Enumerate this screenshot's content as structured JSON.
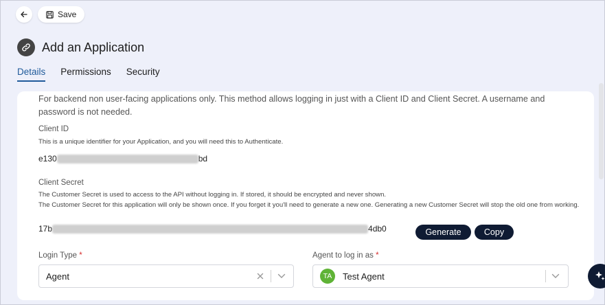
{
  "toolbar": {
    "save_label": "Save"
  },
  "page": {
    "title": "Add an Application"
  },
  "tabs": [
    {
      "label": "Details",
      "active": true
    },
    {
      "label": "Permissions",
      "active": false
    },
    {
      "label": "Security",
      "active": false
    }
  ],
  "content": {
    "description": "For backend non user-facing applications only. This method allows logging in just with a Client ID and Client Secret. A username and password is not needed.",
    "client_id": {
      "label": "Client ID",
      "help": "This is a unique identifier for your Application, and you will need this to Authenticate.",
      "value_prefix": "e130",
      "value_suffix": "bd"
    },
    "client_secret": {
      "label": "Client Secret",
      "help_1": "The Customer Secret is used to access to the API without logging in. If stored, it should be encrypted and never shown.",
      "help_2": "The Customer Secret for this application will only be shown once. If you forget it you'll need to generate a new one. Generating a new Customer Secret will stop the old one from working.",
      "value_prefix": "17b",
      "value_suffix": "4db0",
      "generate_label": "Generate",
      "copy_label": "Copy"
    },
    "login_type": {
      "label": "Login Type",
      "required_mark": "*",
      "value": "Agent"
    },
    "agent": {
      "label": "Agent to log in as",
      "required_mark": "*",
      "initials": "TA",
      "value": "Test Agent"
    }
  },
  "colors": {
    "accent": "#1f5a9a",
    "dark_button": "#0f1b33",
    "avatar": "#5fb336",
    "required": "#d62d2d",
    "background": "#eef0fa"
  },
  "icons": [
    "back-arrow-icon",
    "save-icon",
    "link-icon",
    "clear-icon",
    "chevron-down-icon",
    "sparkle-icon"
  ]
}
